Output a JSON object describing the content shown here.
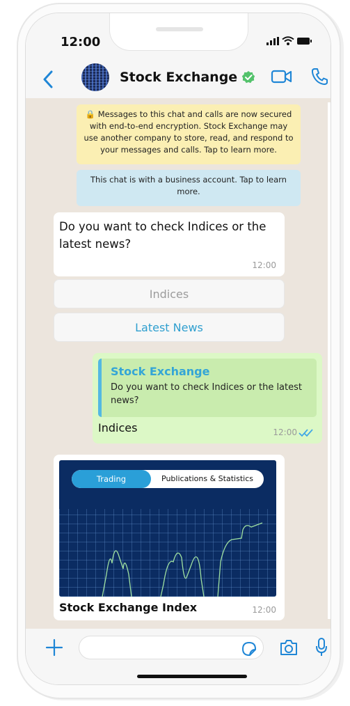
{
  "status": {
    "time": "12:00"
  },
  "header": {
    "contact_name": "Stock Exchange"
  },
  "chat": {
    "encryption_notice": "🔒 Messages to this chat and calls are now secured with end-to-end encryption. Stock Exchange may use another company to store, read, and respond to your messages and calls. Tap to learn more.",
    "business_notice": "This chat is with a business account. Tap to learn more.",
    "incoming": {
      "text": "Do you want to check Indices or the latest news?",
      "time": "12:00"
    },
    "quick_replies": [
      {
        "label": "Indices",
        "state": "disabled"
      },
      {
        "label": "Latest News",
        "state": "active"
      }
    ],
    "outgoing": {
      "quoted_sender": "Stock Exchange",
      "quoted_text": "Do you want to check Indices or the latest news?",
      "text": "Indices",
      "time": "12:00"
    },
    "image_card": {
      "tab_active": "Trading",
      "tab_inactive": "Publications & Statistics",
      "caption": "Stock Exchange Index",
      "time": "12:00"
    }
  },
  "composer": {
    "placeholder": ""
  },
  "colors": {
    "accent": "#2f9fcf",
    "outgoing_bubble": "#dcf8c6",
    "chat_bg": "#ece5dd"
  }
}
